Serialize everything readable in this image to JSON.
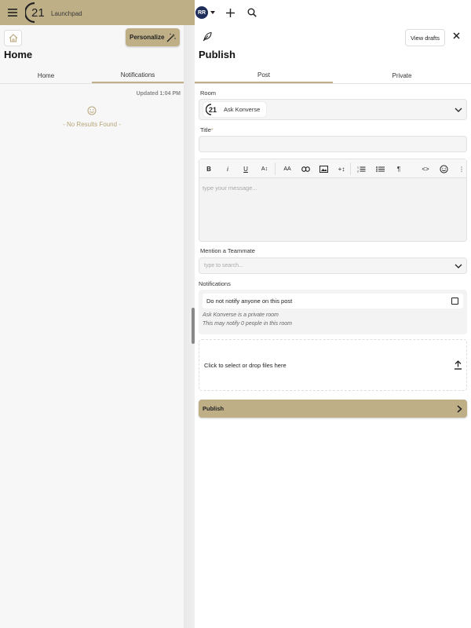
{
  "app": {
    "name": "Launchpad",
    "logo_text": "21",
    "brand_color": "#beaf87",
    "avatar_initials": "RR",
    "avatar_color": "#1f2e5a"
  },
  "icons": {
    "menu": "hamburger-icon",
    "add": "plus-icon",
    "search": "search-icon",
    "home": "home-icon",
    "personalize": "magic-wand-icon",
    "smile": "smile-icon",
    "feather": "feather-icon",
    "close": "close-icon"
  },
  "left": {
    "personalize_label": "Personalize",
    "title": "Home",
    "tabs": [
      {
        "label": "Home",
        "active": false
      },
      {
        "label": "Notifications",
        "active": true
      }
    ],
    "updated": "Updated 1:04 PM",
    "empty_text": "- No Results Found -"
  },
  "publish": {
    "view_drafts_label": "View drafts",
    "title": "Publish",
    "tabs": [
      {
        "label": "Post",
        "active": true
      },
      {
        "label": "Private",
        "active": false
      }
    ],
    "room_label": "Room",
    "room_value": "Ask Konverse",
    "title_label": "Title",
    "title_required": "*",
    "title_value": "",
    "toolbar": {
      "bold": "B",
      "italic": "i",
      "underline": "U",
      "text_size": "A↕",
      "font": "AA",
      "link": "link-icon",
      "image": "image-icon",
      "insert": "+↕",
      "ordered_list": "ordered-list-icon",
      "bullet_list": "bullet-list-icon",
      "paragraph": "¶",
      "code": "<>",
      "emoji": "emoji-icon",
      "more": "⋮"
    },
    "message_placeholder": "type your message...",
    "mention_label": "Mention a Teammate",
    "mention_placeholder": "type to search...",
    "notifications_label": "Notifications",
    "do_not_notify_label": "Do not notify anyone on this post",
    "do_not_notify_checked": false,
    "private_note": "Ask Konverse is a private room",
    "notify_note": "This may notify 0 people in this room",
    "dropzone_text": "Click to select or drop files here",
    "publish_label": "Publish"
  }
}
